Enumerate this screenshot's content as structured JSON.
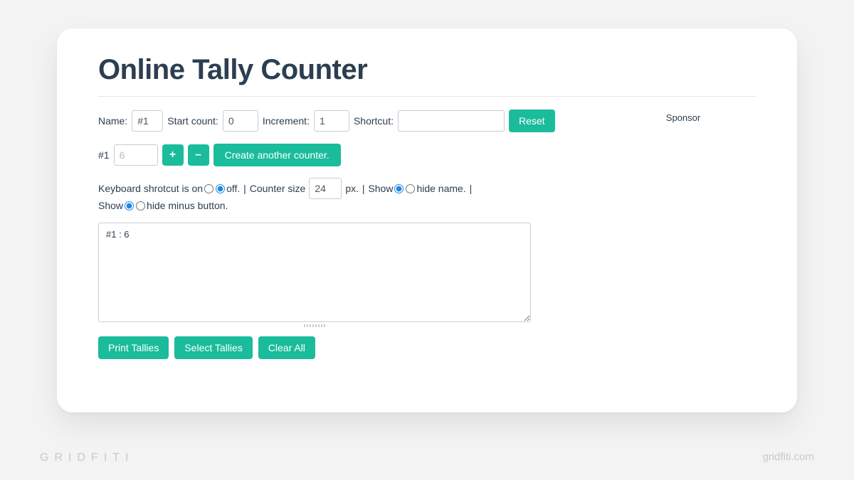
{
  "title": "Online Tally Counter",
  "form": {
    "name_label": "Name:",
    "name_value": "#1",
    "start_label": "Start count:",
    "start_value": "0",
    "increment_label": "Increment:",
    "increment_value": "1",
    "shortcut_label": "Shortcut:",
    "shortcut_value": "",
    "reset_label": "Reset"
  },
  "counter": {
    "label": "#1",
    "value": "6",
    "plus": "+",
    "minus": "–",
    "create_label": "Create another counter."
  },
  "settings": {
    "prefix": "Keyboard shrotcut is on",
    "off_word": "off.",
    "sep": " | ",
    "size_prefix": "Counter size",
    "size_value": "24",
    "size_suffix": "px.",
    "show_word": "Show",
    "hide_name": "hide name.",
    "hide_minus": "hide minus button.",
    "shortcut_on_checked": false,
    "shortcut_off_checked": true,
    "show_name_checked": true,
    "hide_name_checked": false,
    "show_minus_checked": true,
    "hide_minus_checked": false
  },
  "output": "#1 : 6",
  "buttons": {
    "print": "Print Tallies",
    "select": "Select Tallies",
    "clear": "Clear All"
  },
  "sponsor_label": "Sponsor",
  "footer": {
    "brand": "GRIDFITI",
    "url": "gridfiti.com"
  }
}
